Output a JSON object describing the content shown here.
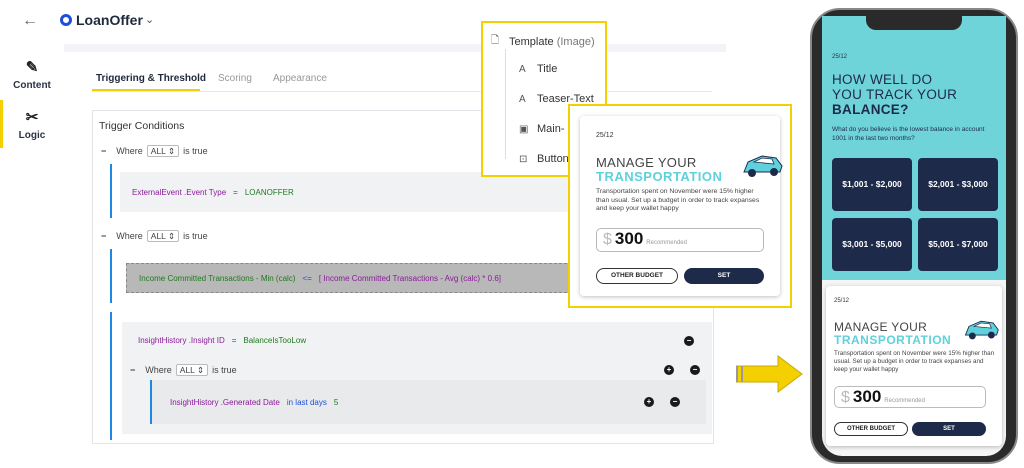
{
  "header": {
    "back_icon": "arrow-left-icon",
    "app_name": "LoanOffer"
  },
  "sidebar": {
    "items": [
      {
        "label": "Content",
        "icon": "edit-icon"
      },
      {
        "label": "Logic",
        "icon": "tools-icon",
        "active": true
      }
    ]
  },
  "tabs": [
    {
      "label": "Triggering & Threshold",
      "active": true
    },
    {
      "label": "Scoring"
    },
    {
      "label": "Appearance"
    }
  ],
  "trigger": {
    "title": "Trigger Conditions",
    "where_label": "Where",
    "where_value": "ALL",
    "is_true": "is true",
    "cond1": {
      "field": "ExternalEvent",
      "attr": ".Event Type",
      "op": "=",
      "value": "LOANOFFER"
    },
    "cond2": {
      "field": "Income Committed Transactions - Min (calc)",
      "op": "<=",
      "value": "[ Income Committed Transactions - Avg (calc) * 0.6]"
    },
    "cond3": {
      "field": "InsightHistory",
      "attr": ".Insight ID",
      "op": "=",
      "value": "BalanceIsTooLow"
    },
    "cond4": {
      "field": "InsightHistory",
      "attr": ".Generated Date",
      "op": "in last days",
      "value": "5"
    }
  },
  "template": {
    "title": "Template",
    "title_suffix": "(Image)",
    "items": [
      "Title",
      "Teaser-Text",
      "Main-",
      "Button"
    ]
  },
  "card": {
    "date": "25/12",
    "heading1": "MANAGE YOUR",
    "heading2": "TRANSPORTATION",
    "desc": "Transportation spent on November were 15% higher than usual. Set up a budget in order to track expanses and keep your wallet happy",
    "currency": "$",
    "amount": "300",
    "recommended": "Recommended",
    "btn_other": "OTHER BUDGET",
    "btn_set": "SET"
  },
  "quiz": {
    "date": "25/12",
    "line1": "HOW WELL DO",
    "line2": "YOU TRACK YOUR",
    "line3": "BALANCE?",
    "question": "What do you believe is the lowest balance in account 1001 in the last two months?",
    "options": [
      "$1,001 - $2,000",
      "$2,001 - $3,000",
      "$3,001 - $5,000",
      "$5,001 - $7,000"
    ]
  },
  "colors": {
    "accent": "#f5d000",
    "teal": "#6fd3da",
    "navy": "#1e2a4a",
    "brand_blue": "#1d4fd8"
  }
}
